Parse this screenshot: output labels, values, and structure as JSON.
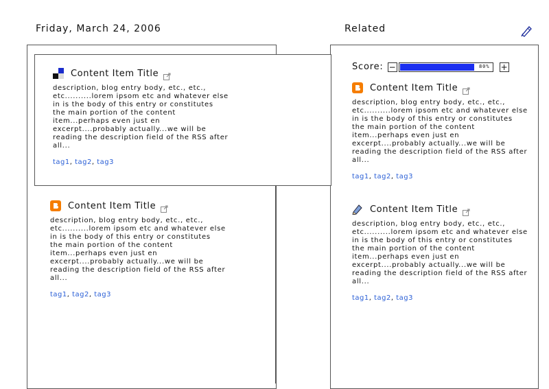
{
  "header": {
    "date": "Friday, March 24, 2006",
    "related": "Related"
  },
  "score": {
    "label": "Score:",
    "minus": "−",
    "plus": "+",
    "percent_text": "80%",
    "value": 0.8,
    "fill_color": "#1b2ff0"
  },
  "items": [
    {
      "icon": "squares-icon",
      "title": "Content Item Title",
      "description": "description, blog entry body, etc., etc., etc..........lorem ipsom etc and whatever else in is the body of this entry or constitutes the main portion of the content item...perhaps even just en excerpt....probably actually...we will be reading the description field of the RSS after all...",
      "tags": [
        "tag1",
        "tag2",
        "tag3"
      ]
    },
    {
      "icon": "blogger-icon",
      "title": "Content Item Title",
      "description": "description, blog entry body, etc., etc., etc..........lorem ipsom etc and whatever else in is the body of this entry or constitutes the main portion of the content item...perhaps even just en excerpt....probably actually...we will be reading the description field of the RSS after all...",
      "tags": [
        "tag1",
        "tag2",
        "tag3"
      ]
    },
    {
      "icon": "blogger-icon",
      "title": "Content Item Title",
      "description": "description, blog entry body, etc., etc., etc..........lorem ipsom etc and whatever else in is the body of this entry or constitutes the main portion of the content item...perhaps even just en excerpt....probably actually...we will be reading the description field of the RSS after all...",
      "tags": [
        "tag1",
        "tag2",
        "tag3"
      ]
    },
    {
      "icon": "pencil-icon",
      "title": "Content Item Title",
      "description": "description, blog entry body, etc., etc., etc..........lorem ipsom etc and whatever else in is the body of this entry or constitutes the main portion of the content item...perhaps even just en excerpt....probably actually...we will be reading the description field of the RSS after all...",
      "tags": [
        "tag1",
        "tag2",
        "tag3"
      ]
    }
  ],
  "colors": {
    "tag_link": "#2a5fd6",
    "blogger_orange": "#f57d00",
    "border": "#555555"
  }
}
